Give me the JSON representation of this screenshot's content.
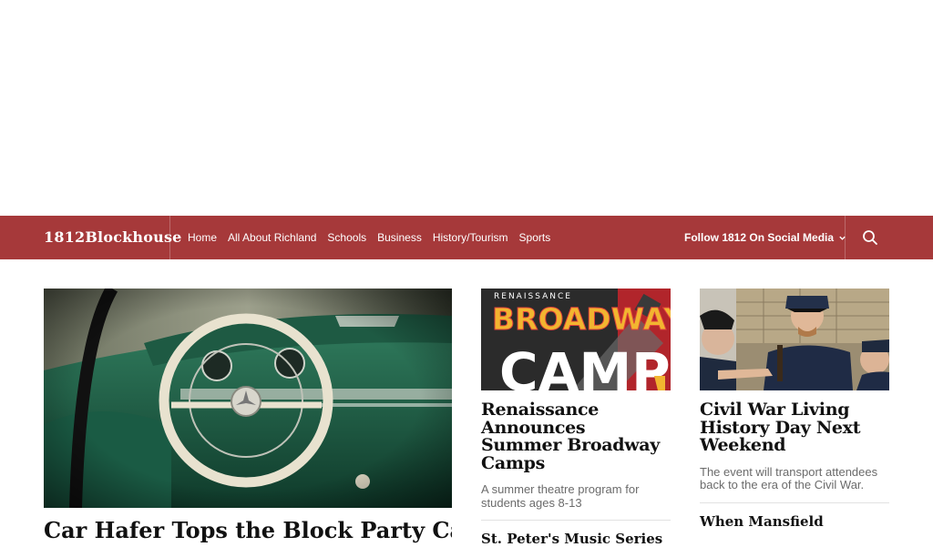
{
  "site": {
    "brand": "1812Blockhouse"
  },
  "nav": {
    "links": [
      "Home",
      "All About Richland",
      "Schools",
      "Business",
      "History/Tourism",
      "Sports"
    ],
    "social_label": "Follow 1812 On Social Media"
  },
  "feature": {
    "title": "Car Hafer Tops the Block Party Car"
  },
  "cards": [
    {
      "image_text_top": "RENAISSANCE",
      "image_text_mid": "BROADWAY",
      "image_text_bottom": "CAMP",
      "title": "Renaissance Announces Summer Broadway Camps",
      "excerpt": "A summer theatre program for students ages 8-13",
      "next_title": "St. Peter's Music Series"
    },
    {
      "title": "Civil War Living History Day Next Weekend",
      "excerpt": "The event will transport attendees back to the era of the Civil War.",
      "next_title": "When Mansfield"
    }
  ],
  "colors": {
    "accent": "#a6393a"
  }
}
